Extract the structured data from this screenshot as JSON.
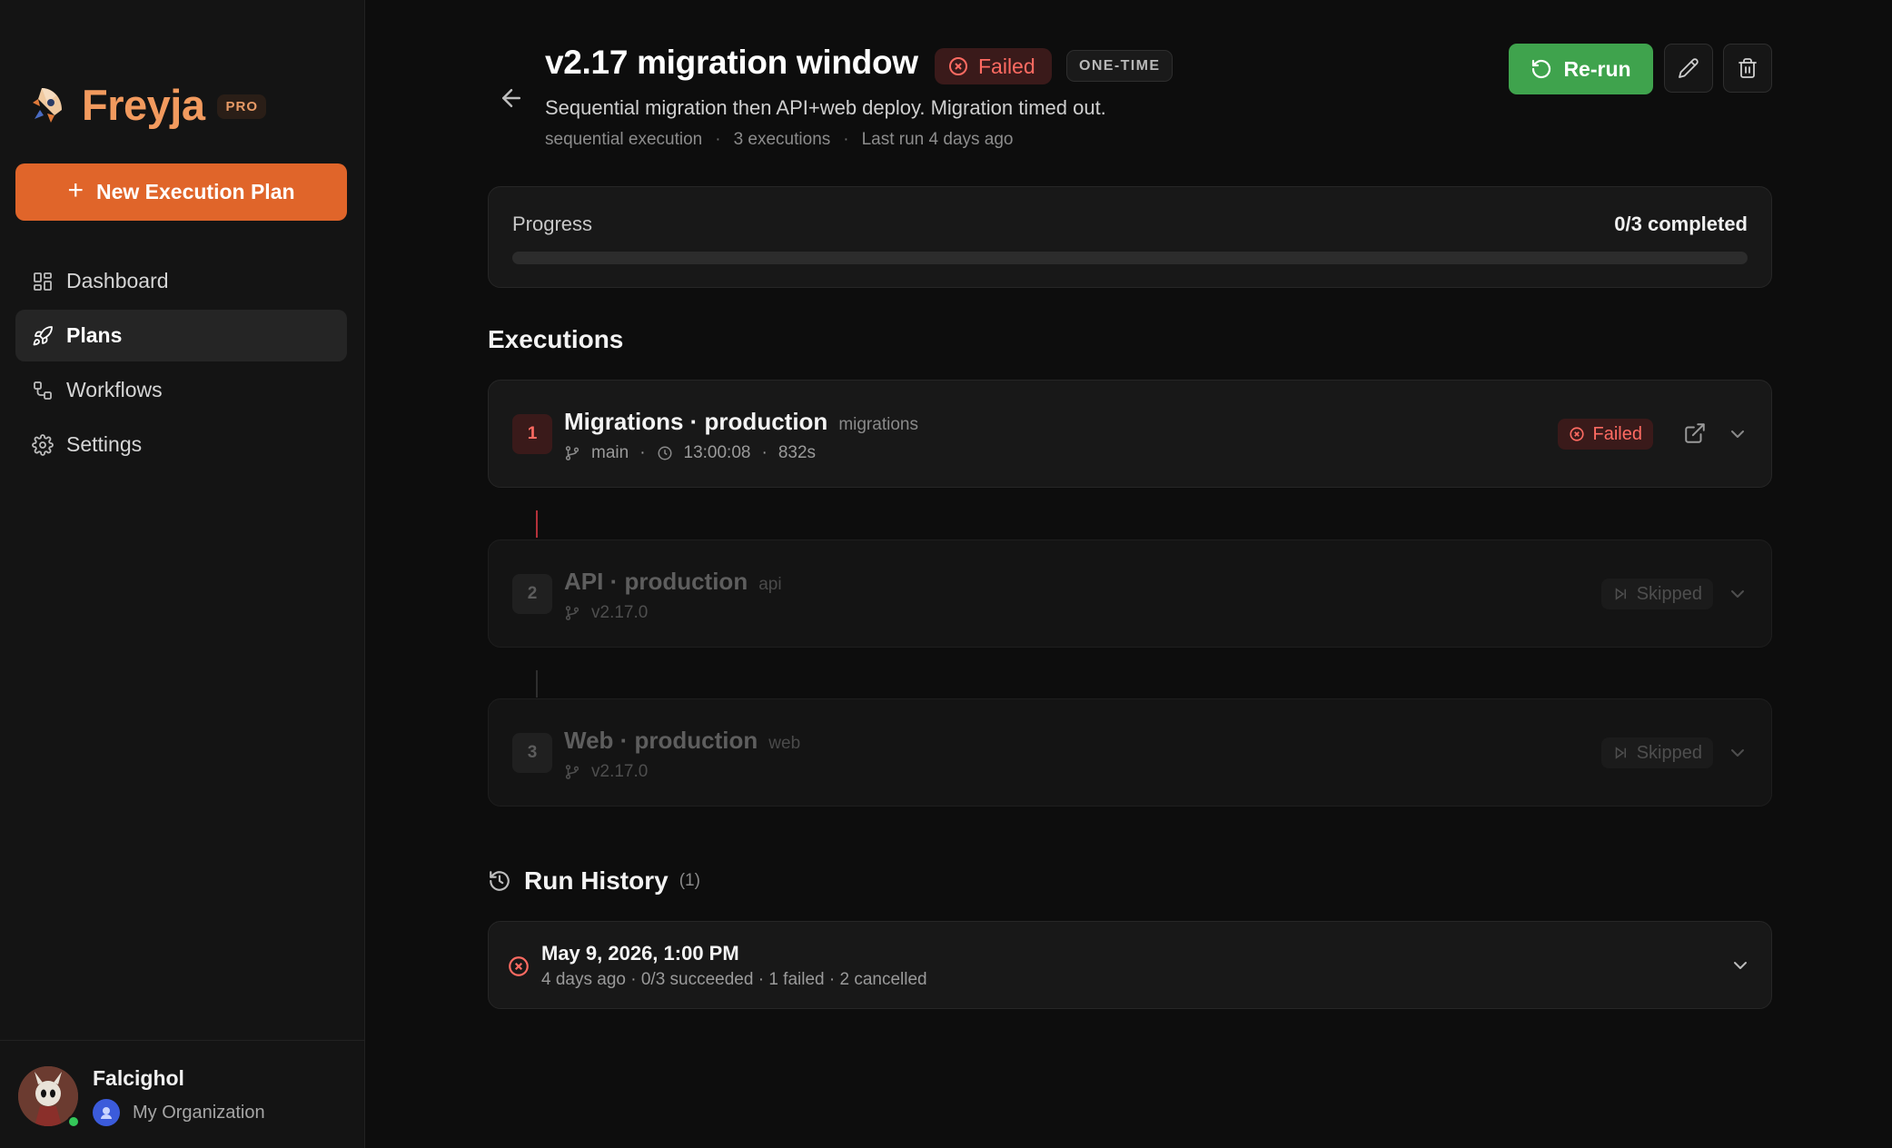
{
  "app": {
    "name": "Freyja",
    "tier_badge": "PRO",
    "new_plan_label": "New Execution Plan",
    "accent_color": "#e0652a"
  },
  "sidebar": {
    "items": [
      {
        "label": "Dashboard",
        "icon": "dashboard-icon",
        "active": false
      },
      {
        "label": "Plans",
        "icon": "rocket-icon",
        "active": true
      },
      {
        "label": "Workflows",
        "icon": "workflow-icon",
        "active": false
      },
      {
        "label": "Settings",
        "icon": "gear-icon",
        "active": false
      }
    ]
  },
  "user": {
    "name": "Falcighol",
    "organization": "My Organization",
    "status": "online"
  },
  "plan": {
    "title": "v2.17 migration window",
    "status": "Failed",
    "type_badge": "ONE-TIME",
    "description": "Sequential migration then API+web deploy. Migration timed out.",
    "meta": {
      "mode": "sequential execution",
      "executions": "3 executions",
      "last_run": "Last run 4 days ago"
    },
    "actions": {
      "rerun_label": "Re-run",
      "rerun_color": "#3fa34d"
    }
  },
  "progress": {
    "label": "Progress",
    "count_text": "0/3 completed",
    "completed": 0,
    "total": 3
  },
  "executions_section": {
    "title": "Executions",
    "items": [
      {
        "number": "1",
        "name": "Migrations · production",
        "tag": "migrations",
        "branch": "main",
        "time": "13:00:08",
        "duration": "832s",
        "status": "Failed"
      },
      {
        "number": "2",
        "name": "API · production",
        "tag": "api",
        "branch": "v2.17.0",
        "status": "Skipped"
      },
      {
        "number": "3",
        "name": "Web · production",
        "tag": "web",
        "branch": "v2.17.0",
        "status": "Skipped"
      }
    ]
  },
  "run_history": {
    "title": "Run History",
    "count": "(1)",
    "runs": [
      {
        "date": "May 9, 2026, 1:00 PM",
        "summary": "4 days ago · 0/3 succeeded · 1 failed · 2 cancelled",
        "status": "failed"
      }
    ]
  },
  "colors": {
    "failed": "#ff6b62",
    "success": "#3fa34d",
    "brand": "#f29a5e"
  }
}
